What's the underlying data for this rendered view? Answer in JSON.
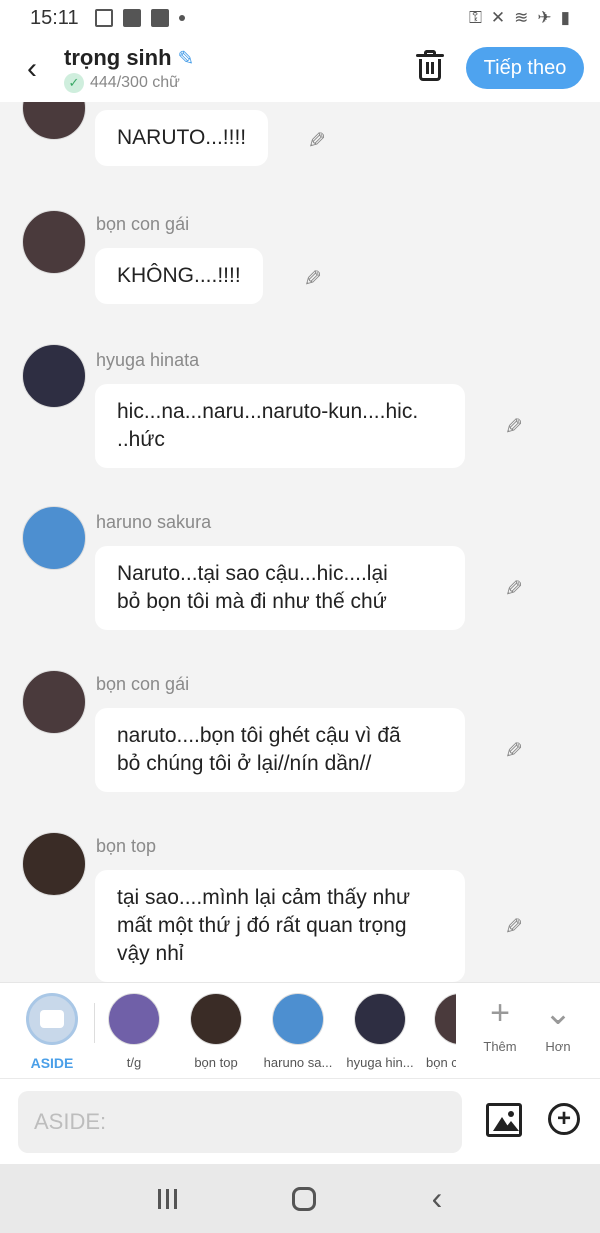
{
  "status_bar": {
    "time": "15:11",
    "notif_icons": [
      "image-icon",
      "baomoi-icon",
      "facebook-icon"
    ],
    "sys_icons": [
      "key-icon",
      "vibrate-mute-icon",
      "wifi-icon",
      "airplane-icon",
      "battery-icon"
    ]
  },
  "header": {
    "title": "trọng sinh",
    "word_count": "444/300 chữ",
    "next_label": "Tiếp theo"
  },
  "messages": [
    {
      "sender": "",
      "text": "NARUTO...!!!!",
      "avatar_color": "#4a3a3c"
    },
    {
      "sender": "bọn con gái",
      "text": "KHÔNG....!!!!",
      "avatar_color": "#4a3a3c"
    },
    {
      "sender": "hyuga hinata",
      "text": "hic...na...naru...naruto-kun....hic.\n..hức",
      "avatar_color": "#2e2e42"
    },
    {
      "sender": "haruno sakura",
      "text": "Naruto...tại sao cậu...hic....lại\nbỏ bọn tôi mà đi như thế chứ",
      "avatar_color": "#4d8fd0"
    },
    {
      "sender": "bọn con gái",
      "text": "naruto....bọn tôi ghét cậu vì đã\nbỏ chúng tôi ở lại//nín dần//",
      "avatar_color": "#4a3a3c"
    },
    {
      "sender": "bọn top",
      "text": "tại sao....mình lại cảm thấy như\nmất một thứ j đó rất quan trọng\nvậy nhỉ",
      "avatar_color": "#3a2c26"
    }
  ],
  "characters": [
    {
      "label": "ASIDE"
    },
    {
      "label": "t/g",
      "color": "#7060a8"
    },
    {
      "label": "bọn top",
      "color": "#3a2c26"
    },
    {
      "label": "haruno sa...",
      "color": "#4d8fd0"
    },
    {
      "label": "hyuga hin...",
      "color": "#2e2e42"
    },
    {
      "label": "bọn c",
      "color": "#4a3a3c"
    }
  ],
  "more_actions": [
    {
      "label": "Thêm",
      "glyph": "+"
    },
    {
      "label": "Hơn",
      "glyph": "⌄"
    }
  ],
  "input": {
    "placeholder": "ASIDE:"
  }
}
